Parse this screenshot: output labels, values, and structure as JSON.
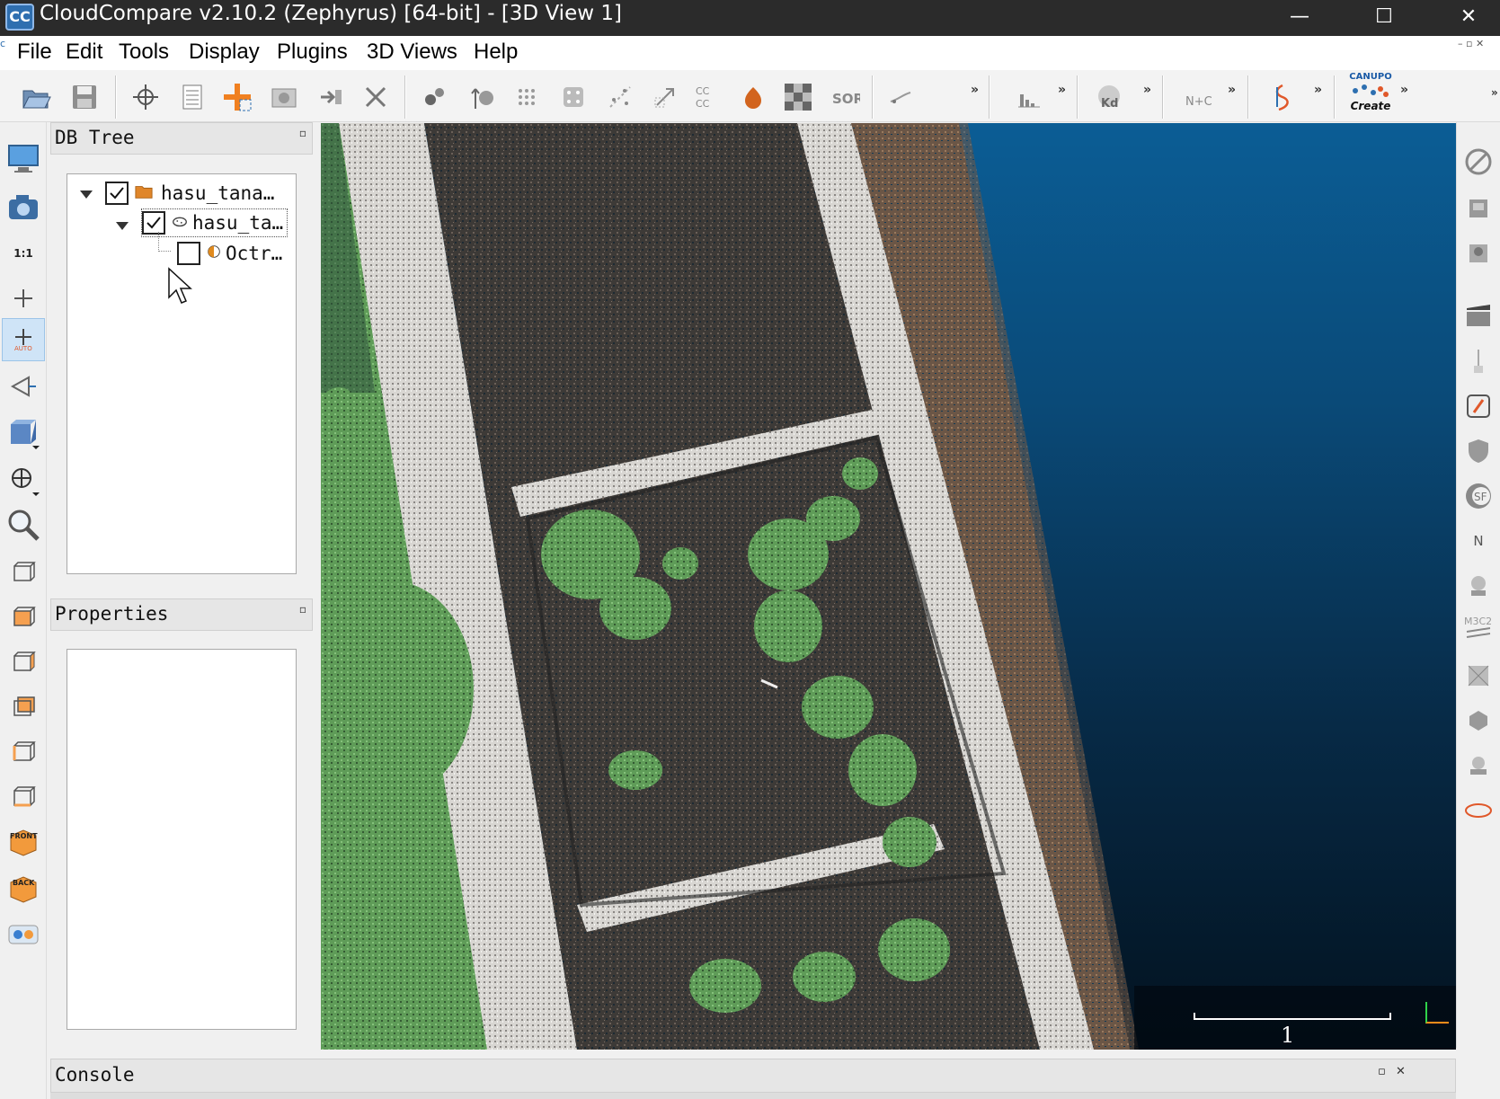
{
  "window": {
    "title": "CloudCompare v2.10.2 (Zephyrus) [64-bit] - [3D View 1]",
    "app_icon_text": "CC",
    "minimize": "—",
    "maximize": "☐",
    "close": "✕"
  },
  "menu": {
    "items": [
      "File",
      "Edit",
      "Tools",
      "Display",
      "Plugins",
      "3D Views",
      "Help"
    ],
    "mdi_controls": "– ▫ ✕"
  },
  "toolbar": {
    "overflow": "»",
    "labels": {
      "sor": "SOR",
      "kd": "Kd",
      "nc": "N+C",
      "canupo_top": "CANUPO",
      "canupo_bottom": "Create",
      "cc": "CC"
    }
  },
  "left_toolbar": {
    "one_to_one": "1:1",
    "front": "FRONT",
    "back": "BACK",
    "auto": "AUTO"
  },
  "right_toolbar": {
    "sf": "SF",
    "n": "N",
    "m3c2": "M3C2"
  },
  "db_tree": {
    "title": "DB Tree",
    "float_icon": "▫",
    "items": [
      {
        "label": "hasu_tana…",
        "checked": true,
        "level": 0,
        "icon": "folder-icon"
      },
      {
        "label": "hasu_ta…",
        "checked": true,
        "level": 1,
        "icon": "cloud-icon"
      },
      {
        "label": "Octr…",
        "checked": false,
        "level": 2,
        "icon": "octree-icon"
      }
    ]
  },
  "properties": {
    "title": "Properties",
    "float_icon": "▫"
  },
  "view3d": {
    "scale_label": "1"
  },
  "console": {
    "title": "Console",
    "float_icon": "▫",
    "close_icon": "✕"
  },
  "colors": {
    "titlebar": "#2b2b2b",
    "background_top": "#0b5d95",
    "background_bottom": "#03121f",
    "road": "#3f3c39",
    "white_lines": "#e8e6e3",
    "vegetation": "#6aa964",
    "brown_soil": "#8a6a52"
  }
}
